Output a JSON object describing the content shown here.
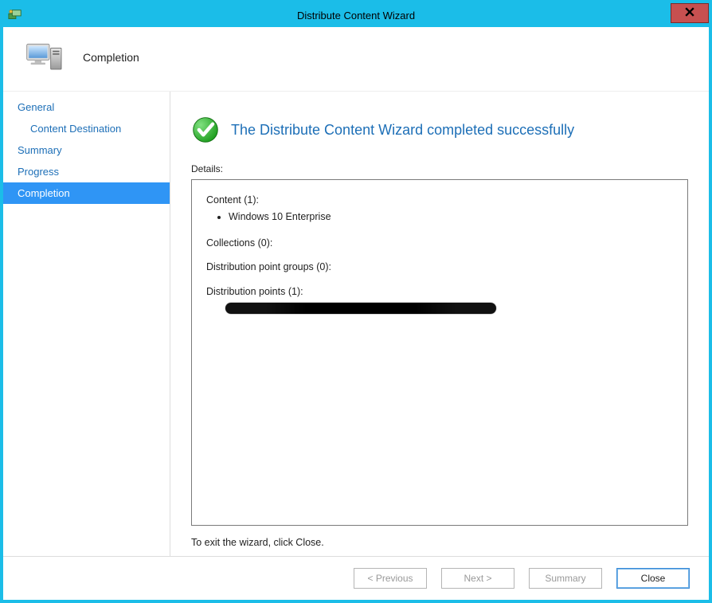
{
  "window": {
    "title": "Distribute Content Wizard"
  },
  "header": {
    "title": "Completion"
  },
  "sidebar": {
    "items": [
      {
        "label": "General",
        "indent": false,
        "selected": false
      },
      {
        "label": "Content Destination",
        "indent": true,
        "selected": false
      },
      {
        "label": "Summary",
        "indent": false,
        "selected": false
      },
      {
        "label": "Progress",
        "indent": false,
        "selected": false
      },
      {
        "label": "Completion",
        "indent": false,
        "selected": true
      }
    ]
  },
  "main": {
    "success_message": "The Distribute Content Wizard completed successfully",
    "details_label": "Details:",
    "content_heading": "Content (1):",
    "content_items": [
      "Windows 10 Enterprise"
    ],
    "collections_heading": "Collections (0):",
    "dpgroups_heading": "Distribution point groups (0):",
    "dp_heading": "Distribution points (1):",
    "exit_text": "To exit the wizard, click Close."
  },
  "footer": {
    "previous": "< Previous",
    "next": "Next >",
    "summary": "Summary",
    "close": "Close"
  }
}
